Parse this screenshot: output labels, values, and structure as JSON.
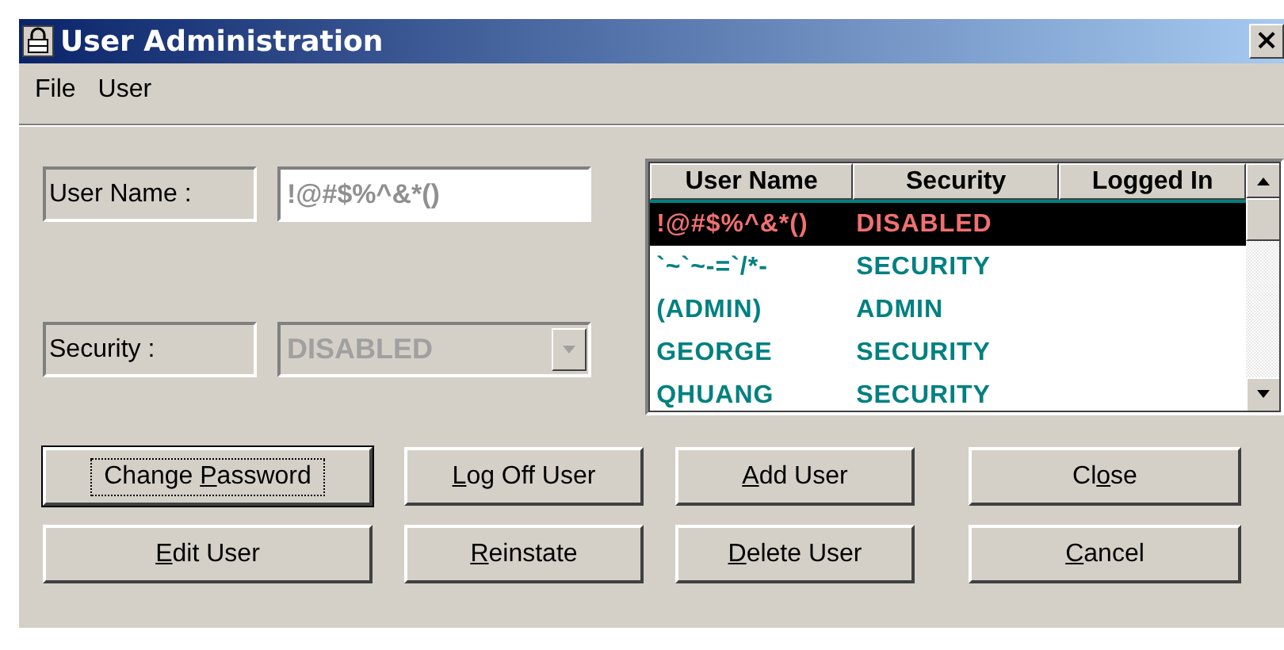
{
  "window": {
    "title": "User Administration",
    "close_glyph": "×"
  },
  "menu": [
    "File",
    "User"
  ],
  "user_name": {
    "label": "User Name :",
    "value": "!@#$%^&*()"
  },
  "security": {
    "label": "Security :",
    "value": "DISABLED",
    "disabled": true
  },
  "table": {
    "columns": [
      "User Name",
      "Security",
      "Logged In"
    ],
    "rows": [
      {
        "user": "!@#$%^&*()",
        "security": "DISABLED",
        "selected": true
      },
      {
        "user": "`~`~-=`/*-",
        "security": "SECURITY",
        "selected": false
      },
      {
        "user": "(ADMIN)",
        "security": "ADMIN",
        "selected": false
      },
      {
        "user": "GEORGE",
        "security": "SECURITY",
        "selected": false
      },
      {
        "user": "QHUANG",
        "security": "SECURITY",
        "selected": false
      }
    ]
  },
  "buttons": [
    {
      "label_before": "Change ",
      "access_key": "P",
      "label_after": "assword",
      "focused": true
    },
    {
      "access_key": "L",
      "label_after": "og Off User",
      "focused": false
    },
    {
      "access_key": "A",
      "label_after": "dd User",
      "focused": false
    },
    {
      "label_before": "Cl",
      "access_key": "o",
      "label_after": "se",
      "focused": false
    },
    {
      "access_key": "E",
      "label_after": "dit User",
      "focused": false
    },
    {
      "access_key": "R",
      "label_after": "einstate",
      "focused": false
    },
    {
      "access_key": "D",
      "label_after": "elete User",
      "focused": false
    },
    {
      "access_key": "C",
      "label_after": "ancel",
      "focused": false
    }
  ]
}
